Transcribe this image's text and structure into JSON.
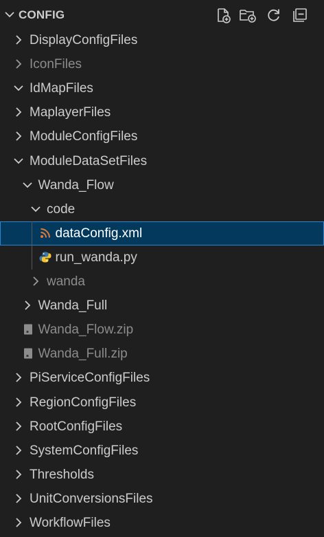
{
  "header": {
    "title": "CONFIG",
    "actions": [
      {
        "name": "new-file-icon",
        "tooltip": "New File..."
      },
      {
        "name": "new-folder-icon",
        "tooltip": "New Folder..."
      },
      {
        "name": "refresh-icon",
        "tooltip": "Refresh Explorer"
      },
      {
        "name": "collapse-all-icon",
        "tooltip": "Collapse Folders in Explorer"
      }
    ]
  },
  "tree": [
    {
      "label": "DisplayConfigFiles",
      "kind": "folder",
      "expanded": false,
      "depth": 0
    },
    {
      "label": "IconFiles",
      "kind": "folder",
      "expanded": false,
      "depth": 0,
      "dim": true
    },
    {
      "label": "IdMapFiles",
      "kind": "folder",
      "expanded": true,
      "depth": 0
    },
    {
      "label": "MaplayerFiles",
      "kind": "folder",
      "expanded": false,
      "depth": 0
    },
    {
      "label": "ModuleConfigFiles",
      "kind": "folder",
      "expanded": false,
      "depth": 0
    },
    {
      "label": "ModuleDataSetFiles",
      "kind": "folder",
      "expanded": true,
      "depth": 0
    },
    {
      "label": "Wanda_Flow",
      "kind": "folder",
      "expanded": true,
      "depth": 1
    },
    {
      "label": "code",
      "kind": "folder",
      "expanded": true,
      "depth": 2
    },
    {
      "label": "dataConfig.xml",
      "kind": "file",
      "icon": "rss-icon",
      "depth": 3,
      "selected": true
    },
    {
      "label": "run_wanda.py",
      "kind": "file",
      "icon": "python-icon",
      "depth": 3
    },
    {
      "label": "wanda",
      "kind": "folder",
      "expanded": false,
      "depth": 2,
      "dim": true
    },
    {
      "label": "Wanda_Full",
      "kind": "folder",
      "expanded": false,
      "depth": 1
    },
    {
      "label": "Wanda_Flow.zip",
      "kind": "file",
      "icon": "zip-file-icon",
      "depth": 1,
      "dim": true
    },
    {
      "label": "Wanda_Full.zip",
      "kind": "file",
      "icon": "zip-file-icon",
      "depth": 1,
      "dim": true
    },
    {
      "label": "PiServiceConfigFiles",
      "kind": "folder",
      "expanded": false,
      "depth": 0
    },
    {
      "label": "RegionConfigFiles",
      "kind": "folder",
      "expanded": false,
      "depth": 0
    },
    {
      "label": "RootConfigFiles",
      "kind": "folder",
      "expanded": false,
      "depth": 0
    },
    {
      "label": "SystemConfigFiles",
      "kind": "folder",
      "expanded": false,
      "depth": 0
    },
    {
      "label": "Thresholds",
      "kind": "folder",
      "expanded": false,
      "depth": 0
    },
    {
      "label": "UnitConversionsFiles",
      "kind": "folder",
      "expanded": false,
      "depth": 0
    },
    {
      "label": "WorkflowFiles",
      "kind": "folder",
      "expanded": false,
      "depth": 0
    }
  ],
  "colors": {
    "background": "#1f1f1f",
    "text": "#cccccc",
    "dim_text": "#8c8c8c",
    "selection_bg": "#04395e",
    "selection_border": "#2b86cf",
    "rss": "#e37933",
    "python_blue": "#3c78aa",
    "python_yellow": "#f5c52f",
    "zip": "#8c8c8c"
  }
}
